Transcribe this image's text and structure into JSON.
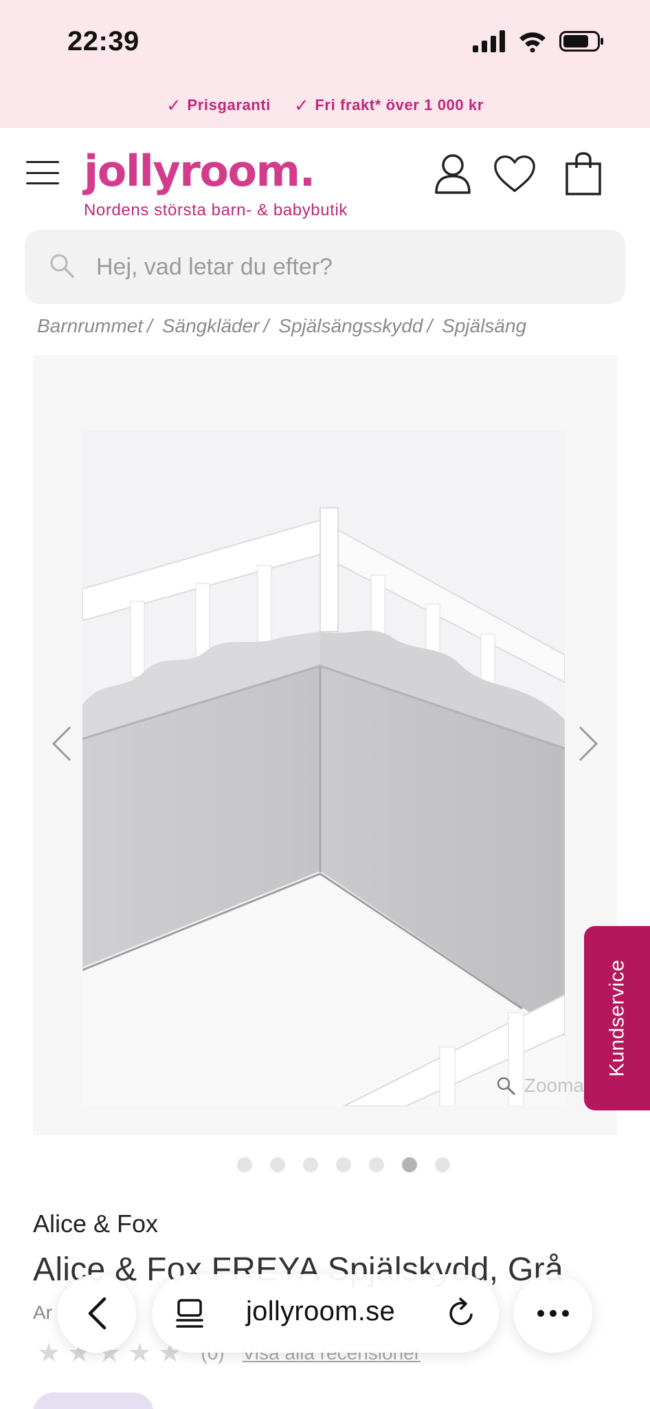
{
  "status_bar": {
    "time": "22:39"
  },
  "promo": {
    "items": [
      {
        "icon": "check-icon",
        "label": "Prisgaranti"
      },
      {
        "icon": "check-icon",
        "label": "Fri frakt* över 1 000 kr"
      }
    ]
  },
  "header": {
    "logo": "jollyroom.",
    "tagline": "Nordens största barn- & babybutik",
    "icons": [
      "menu-icon",
      "account-icon",
      "wishlist-heart-icon",
      "shopping-bag-icon"
    ]
  },
  "search": {
    "placeholder": "Hej, vad letar du efter?"
  },
  "breadcrumb": [
    "Barnrummet",
    "Sängkläder",
    "Spjälsängsskydd",
    "Spjälsäng"
  ],
  "gallery": {
    "zoom_label": "Zooma",
    "slide_count": 7,
    "active_slide": 6
  },
  "kundservice": {
    "label": "Kundservice"
  },
  "product": {
    "brand": "Alice & Fox",
    "title": "Alice & Fox FREYA Spjälskydd, Grå",
    "art_prefix": "Ar",
    "rating_stars": 0,
    "review_count": "(0)",
    "reviews_link": "Visa alla recensioner"
  },
  "browser": {
    "url": "jollyroom.se"
  },
  "colors": {
    "brand_pink": "#d33b8d",
    "kundservice_bg": "#b5175c",
    "promo_bg": "#fce8ec"
  }
}
